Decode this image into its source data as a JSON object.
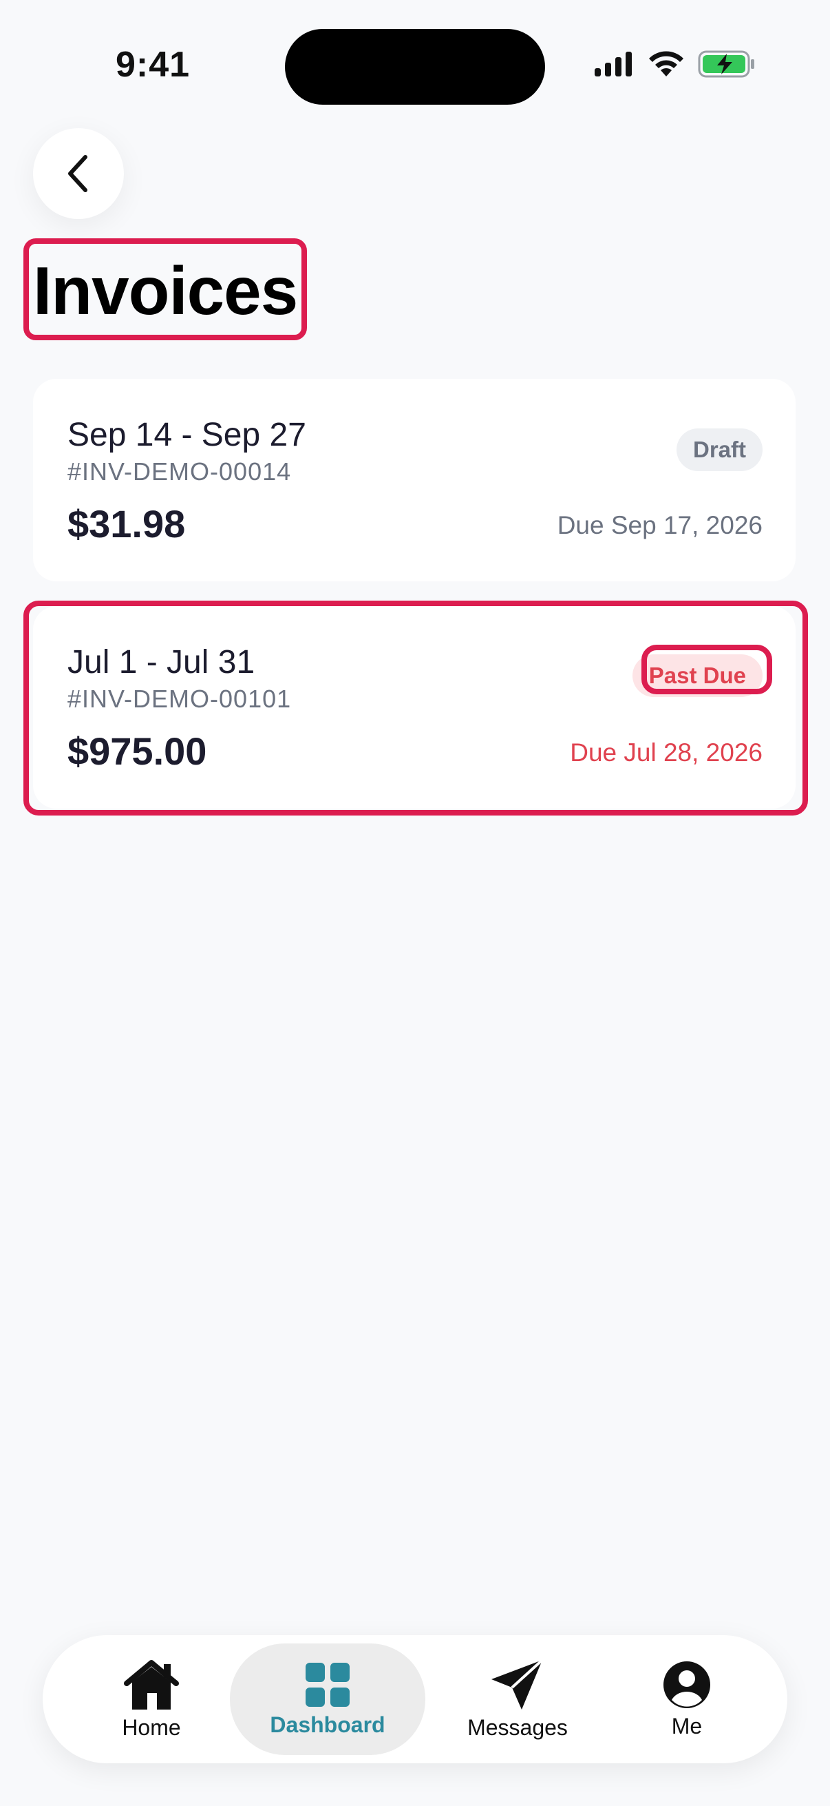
{
  "status": {
    "time": "9:41"
  },
  "header": {
    "title": "Invoices"
  },
  "invoices": [
    {
      "period": "Sep 14 - Sep 27",
      "number": "#INV-DEMO-00014",
      "amount": "$31.98",
      "due": "Due Sep 17, 2026",
      "status": "Draft"
    },
    {
      "period": "Jul 1 - Jul 31",
      "number": "#INV-DEMO-00101",
      "amount": "$975.00",
      "due": "Due Jul 28, 2026",
      "status": "Past Due"
    }
  ],
  "tabs": [
    {
      "label": "Home",
      "icon": "home-icon"
    },
    {
      "label": "Dashboard",
      "icon": "dashboard-icon"
    },
    {
      "label": "Messages",
      "icon": "paper-plane-icon"
    },
    {
      "label": "Me",
      "icon": "user-icon"
    }
  ],
  "colors": {
    "accent": "#2b8a9e",
    "danger": "#e0424f",
    "highlight": "#dc1d4f"
  }
}
